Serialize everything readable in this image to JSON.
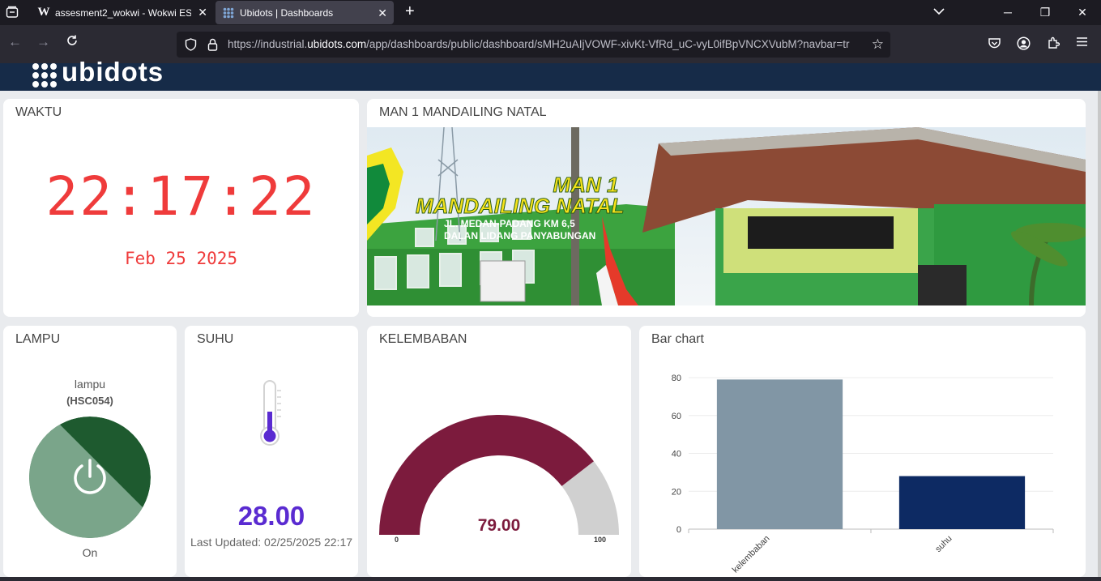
{
  "browser": {
    "tabs": [
      {
        "title": "assesment2_wokwi - Wokwi ESP",
        "favicon": "W"
      },
      {
        "title": "Ubidots | Dashboards"
      }
    ],
    "url_prefix": "https://industrial.",
    "url_domain": "ubidots.com",
    "url_rest": "/app/dashboards/public/dashboard/sMH2uAIjVOWF-xivKt-VfRd_uC-vyL0ifBpVNCXVubM?navbar=tr"
  },
  "header": {
    "logo_text": "ubidots"
  },
  "widgets": {
    "waktu": {
      "title": "WAKTU",
      "time": "22:17:22",
      "date": "Feb 25 2025"
    },
    "banner": {
      "title": "MAN 1 MANDAILING NATAL",
      "line1": "MAN 1",
      "line2": "MANDAILING NATAL",
      "addr1": "JL. MEDAN-PADANG KM 6,5",
      "addr2": "DALAN LIDANG PANYABUNGAN"
    },
    "lampu": {
      "title": "LAMPU",
      "label": "lampu",
      "device": "(HSC054)",
      "state": "On"
    },
    "suhu": {
      "title": "SUHU",
      "value": "28.00",
      "updated": "Last Updated: 02/25/2025 22:17"
    },
    "kelembaban": {
      "title": "KELEMBABAN",
      "value": "79.00",
      "min_label": "0",
      "max_label": "100",
      "gauge_value": 79
    }
  },
  "chart_data": {
    "type": "bar",
    "title": "Bar chart",
    "categories": [
      "kelembaban",
      "suhu"
    ],
    "values": [
      79,
      28
    ],
    "colors": [
      "#8196a5",
      "#0d2a63"
    ],
    "ylim": [
      0,
      80
    ],
    "yticks": [
      "0",
      "20",
      "40",
      "60",
      "80"
    ],
    "grid": true
  }
}
